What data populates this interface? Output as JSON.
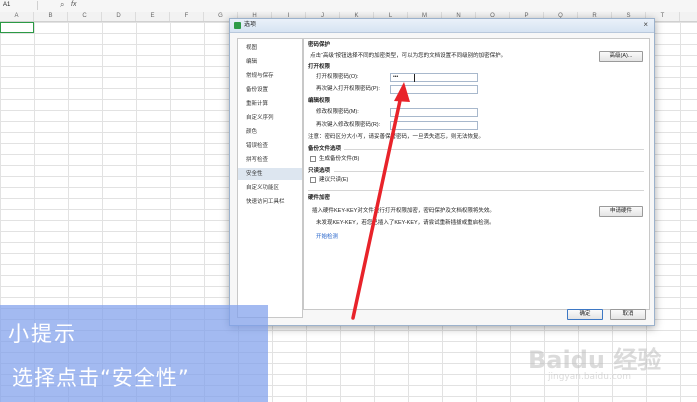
{
  "sheet": {
    "cell_ref": "A1",
    "fx_label": "fx",
    "columns": [
      "A",
      "B",
      "C",
      "D",
      "E",
      "F",
      "G",
      "H",
      "I",
      "J",
      "K",
      "L",
      "M",
      "N",
      "O",
      "P",
      "Q",
      "R",
      "S",
      "T"
    ]
  },
  "dialog": {
    "title": "选项",
    "close_glyph": "×",
    "nav_items": [
      "视图",
      "编辑",
      "常规与保存",
      "备份设置",
      "重新计算",
      "自定义序列",
      "颜色",
      "错误检查",
      "拼写检查",
      "安全性",
      "自定义功能区",
      "快速访问工具栏"
    ],
    "active_nav": "安全性",
    "doc_protection": {
      "heading": "密码保护",
      "desc": "点击“高级”按钮选择不同的加密类型，可以为您的文档设置不同级别的加密保护。",
      "advanced_button": "高级(A)..."
    },
    "open_permission": {
      "heading": "打开权限",
      "password_label": "打开权限密码(O):",
      "password_value": "•••",
      "confirm_label": "再次键入打开权限密码(P):",
      "confirm_value": ""
    },
    "edit_permission": {
      "heading": "编辑权限",
      "password_label": "修改权限密码(M):",
      "password_value": "",
      "confirm_label": "再次键入修改权限密码(R):",
      "confirm_value": ""
    },
    "notice": "注意：密码区分大小写，请妥善保管密码，一旦丢失遗忘，则无法恢复。",
    "backup": {
      "heading": "备份文件选项",
      "checkbox_label": "生成备份文件(B)"
    },
    "readonly": {
      "heading": "只读选项",
      "checkbox_label": "建议只读(E)"
    },
    "hardware": {
      "heading": "硬件加密",
      "line1": "插入硬件KEY-KEY对文件进行打开权限加密，密码保护及文档权限将失效。",
      "line2": "未发现KEY-KEY，若您已插入了KEY-KEY，请尝试重新插拔或重启检测。",
      "button": "申请硬件",
      "link": "开始检测"
    },
    "ok_button": "确定",
    "cancel_button": "取消"
  },
  "hint": {
    "title": "小提示",
    "text": "选择点击“安全性”"
  },
  "watermark": {
    "text": "Baidu 经验",
    "sub": "jingyan.baidu.com"
  },
  "colors": {
    "accent_green": "#2b9a45",
    "arrow_red": "#e8232a",
    "overlay_blue": "#80a0eb"
  }
}
